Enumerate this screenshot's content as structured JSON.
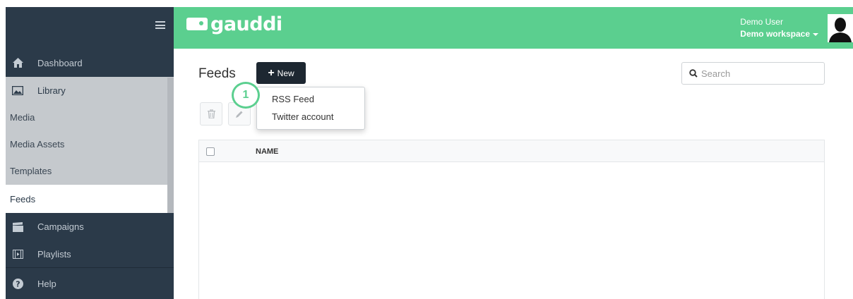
{
  "brand": {
    "name": "gauddi",
    "accent": "#5bcf8f",
    "sidebar_bg": "#2b3a49"
  },
  "user": {
    "name": "Demo User",
    "workspace": "Demo workspace"
  },
  "sidebar": {
    "items": [
      {
        "label": "Dashboard",
        "icon": "home-icon"
      },
      {
        "label": "Library",
        "icon": "image-icon"
      },
      {
        "label": "Media"
      },
      {
        "label": "Media Assets"
      },
      {
        "label": "Templates"
      },
      {
        "label": "Feeds",
        "active": true
      },
      {
        "label": "Campaigns",
        "icon": "clapperboard-icon"
      },
      {
        "label": "Playlists",
        "icon": "film-icon"
      },
      {
        "label": "Help",
        "icon": "question-circle-icon"
      }
    ]
  },
  "page": {
    "title": "Feeds",
    "new_button": "New"
  },
  "search": {
    "placeholder": "Search"
  },
  "dropdown": {
    "items": [
      "RSS Feed",
      "Twitter account"
    ]
  },
  "step_badge": "1",
  "table": {
    "columns": [
      "NAME"
    ],
    "rows": []
  }
}
